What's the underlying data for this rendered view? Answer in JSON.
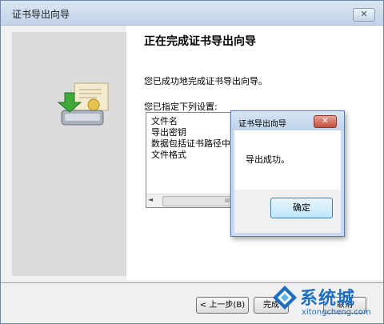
{
  "window": {
    "title": "证书导出向导",
    "close_label": "✕"
  },
  "main": {
    "heading": "正在完成证书导出向导",
    "message": "您已成功地完成证书导出向导。",
    "settings_label": "您已指定下列设置:",
    "settings_items": [
      "文件名",
      "导出密钥",
      "数据包括证书路径中",
      "文件格式"
    ],
    "scroll_thumb_text": "III"
  },
  "footer": {
    "back_label": "< 上一步(B)",
    "finish_label": "完成",
    "cancel_label": "取消"
  },
  "popup": {
    "title": "证书导出向导",
    "close_label": "✕",
    "message": "导出成功。",
    "ok_label": "确定"
  },
  "watermark": {
    "text": "系统城",
    "url": "xitongcheng.com"
  },
  "colors": {
    "accent": "#1f6fc1",
    "close_red": "#c74d3b"
  }
}
